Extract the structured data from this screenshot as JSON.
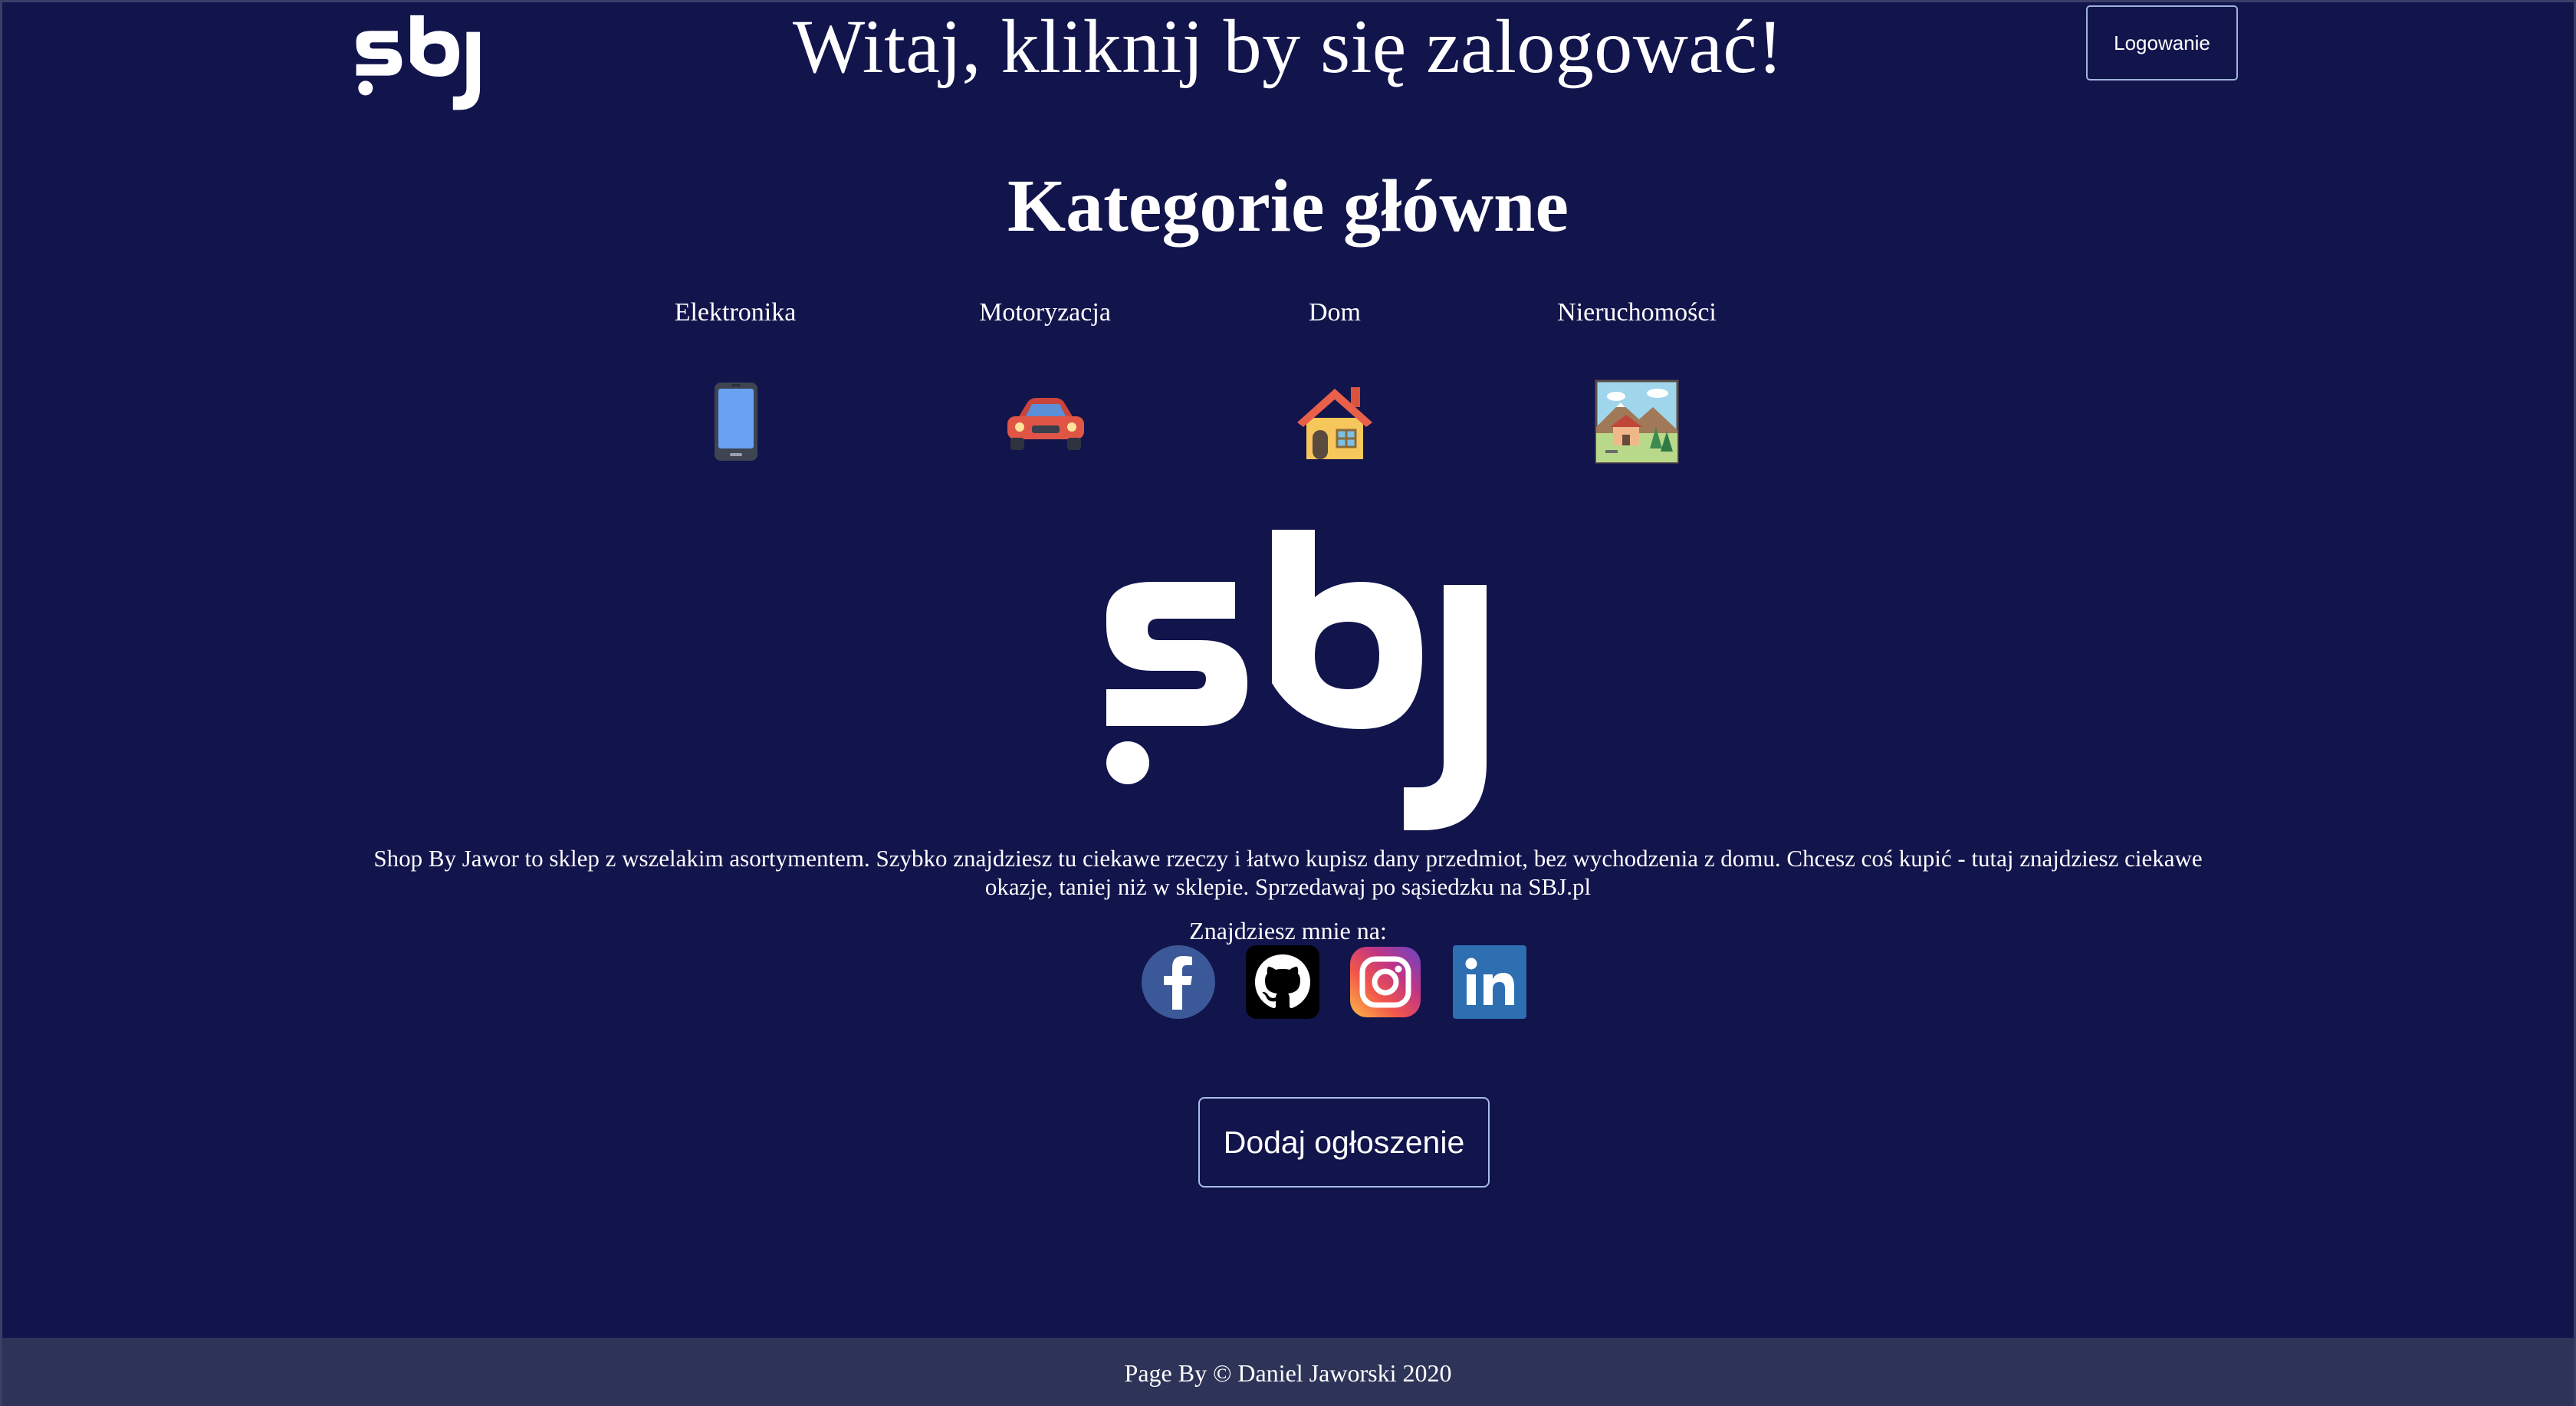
{
  "header": {
    "logo_text": "sbj",
    "greeting": "Witaj, kliknij by się zalogować!",
    "login_label": "Logowanie"
  },
  "categories": {
    "title": "Kategorie główne",
    "items": [
      {
        "label": "Elektronika",
        "icon": "smartphone-icon"
      },
      {
        "label": "Motoryzacja",
        "icon": "car-icon"
      },
      {
        "label": "Dom",
        "icon": "house-icon"
      },
      {
        "label": "Nieruchomości",
        "icon": "landscape-property-icon"
      }
    ]
  },
  "about": {
    "logo_text": "sbj",
    "description": "Shop By Jawor to sklep z wszelakim asortymentem. Szybko znajdziesz tu ciekawe rzeczy i łatwo kupisz dany przedmiot, bez wychodzenia z domu. Chcesz coś kupić - tutaj znajdziesz ciekawe okazje, taniej niż w sklepie. Sprzedawaj po sąsiedzku na SBJ.pl",
    "find_me": "Znajdziesz mnie na:",
    "social": [
      {
        "icon": "facebook-icon",
        "color": "#3b5998"
      },
      {
        "icon": "github-icon",
        "color": "#000000"
      },
      {
        "icon": "instagram-icon",
        "color": "#c13584"
      },
      {
        "icon": "linkedin-icon",
        "color": "#2d6fb1"
      }
    ]
  },
  "actions": {
    "add_listing": "Dodaj ogłoszenie"
  },
  "footer": {
    "text": "Page By © Daniel Jaworski 2020"
  },
  "colors": {
    "background": "#12144c",
    "footer_background": "#2e3458",
    "button_border": "#9fb3da"
  }
}
